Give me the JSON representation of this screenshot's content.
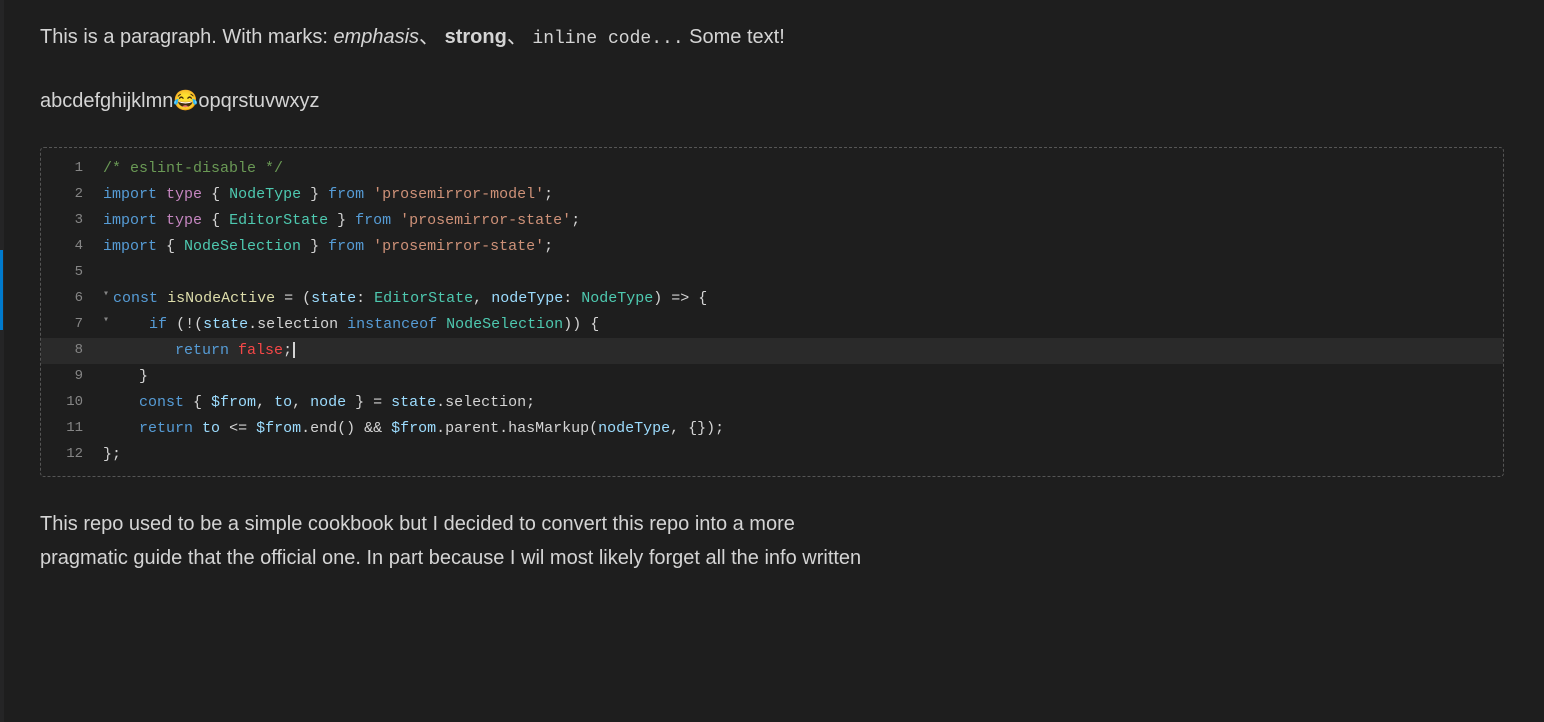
{
  "paragraph": {
    "prefix": "This is a paragraph. With marks: ",
    "emphasis": "emphasis",
    "separator1": "、",
    "strong": "strong",
    "separator2": "、",
    "inline_code": "inline code...",
    "suffix": " Some text!"
  },
  "alphabet": {
    "before_emoji": "abcdefghijklmn",
    "emoji": "😂",
    "after_emoji": "opqrstuvwxyz"
  },
  "code_block": {
    "lines": [
      {
        "number": "1",
        "content": "/* eslint-disable */"
      },
      {
        "number": "2",
        "content": "import type { NodeType } from 'prosemirror-model';"
      },
      {
        "number": "3",
        "content": "import type { EditorState } from 'prosemirror-state';"
      },
      {
        "number": "4",
        "content": "import { NodeSelection } from 'prosemirror-state';"
      },
      {
        "number": "5",
        "content": ""
      },
      {
        "number": "6",
        "content": "const isNodeActive = (state: EditorState, nodeType: NodeType) => {"
      },
      {
        "number": "7",
        "content": "    if (!(state.selection instanceof NodeSelection)) {"
      },
      {
        "number": "8",
        "content": "        return false;"
      },
      {
        "number": "9",
        "content": "    }"
      },
      {
        "number": "10",
        "content": "    const { $from, to, node } = state.selection;"
      },
      {
        "number": "11",
        "content": "    return to <= $from.end() && $from.parent.hasMarkup(nodeType, {});"
      },
      {
        "number": "12",
        "content": "};"
      }
    ]
  },
  "bottom_text": {
    "line1": "This repo used to be a simple cookbook but I decided to convert this repo into a more",
    "line2": "pragmatic guide that the official one. In part because I wil most likely forget all the info written"
  }
}
